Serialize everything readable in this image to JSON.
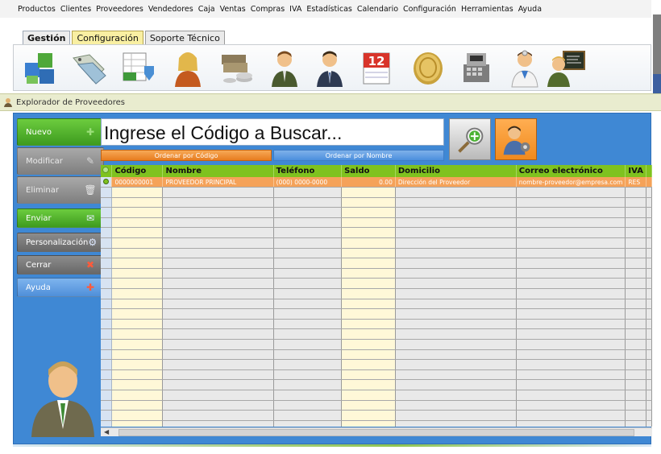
{
  "menu": [
    "Productos",
    "Clientes",
    "Proveedores",
    "Vendedores",
    "Caja",
    "Ventas",
    "Compras",
    "IVA",
    "Estadísticas",
    "Calendario",
    "Configuración",
    "Herramientas",
    "Ayuda"
  ],
  "tabs": [
    {
      "label": "Gestión",
      "state": "active"
    },
    {
      "label": "Configuración",
      "state": "yellow"
    },
    {
      "label": "Soporte Técnico",
      "state": "grey"
    }
  ],
  "ribbon_icons": [
    "products-cubes-icon",
    "price-tags-icon",
    "excel-import-icon",
    "clients-woman-icon",
    "cash-coins-icon",
    "seller-man-icon",
    "supplier-man-icon",
    "calendar-icon",
    "coin-icon",
    "cash-register-icon",
    "doctor-support-icon",
    "teacher-board-icon"
  ],
  "calendar_day": "12",
  "window_title": "Explorador de Proveedores",
  "side_buttons": [
    {
      "label": "Nuevo",
      "style": "green",
      "icon": "plus"
    },
    {
      "label": "Modificar",
      "style": "grey",
      "icon": "pencil"
    },
    {
      "label": "Eliminar",
      "style": "grey",
      "icon": "trash"
    },
    {
      "label": "Enviar",
      "style": "green",
      "icon": "mail"
    },
    {
      "label": "Personalización",
      "style": "dgrey",
      "icon": "settings"
    },
    {
      "label": "Cerrar",
      "style": "dgrey",
      "icon": "close"
    },
    {
      "label": "Ayuda",
      "style": "blue",
      "icon": "help"
    }
  ],
  "search": {
    "placeholder": "Ingrese el Código a Buscar..."
  },
  "sort": {
    "by_code": "Ordenar por Código",
    "by_name": "Ordenar por Nombre"
  },
  "table": {
    "columns": [
      "Código",
      "Nombre",
      "Teléfono",
      "Saldo",
      "Domicilio",
      "Correo electrónico",
      "IVA"
    ],
    "rows": [
      [
        "0000000001",
        "PROVEEDOR PRINCIPAL",
        "(000) 0000-0000",
        "0.00",
        "Dirección del Proveedor",
        "nombre-proveedor@empresa.com",
        "RES"
      ]
    ],
    "empty_rows": 24
  },
  "colors": {
    "accent_orange": "#f08a1d",
    "header_green": "#7fc21f",
    "window_blue": "#3f88d4"
  }
}
